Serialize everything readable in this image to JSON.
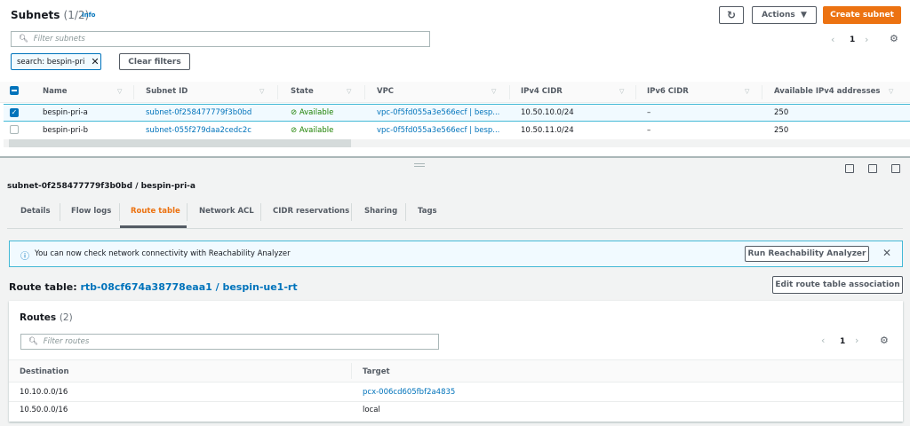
{
  "header": {
    "title": "Subnets",
    "count": "(1/2)",
    "info": "Info",
    "refresh_icon": "refresh-icon",
    "actions": "Actions",
    "create": "Create subnet"
  },
  "filter": {
    "placeholder": "Filter subnets",
    "chip": "search: bespin-pri",
    "clear": "Clear filters"
  },
  "pagination": {
    "page": "1"
  },
  "table": {
    "columns": [
      "Name",
      "Subnet ID",
      "State",
      "VPC",
      "IPv4 CIDR",
      "IPv6 CIDR",
      "Available IPv4 addresses"
    ],
    "rows": [
      {
        "selected": true,
        "name": "bespin-pri-a",
        "id": "subnet-0f258477779f3b0bd",
        "state": "Available",
        "vpc": "vpc-0f5fd055a3e566ecf | besp...",
        "ipv4": "10.50.10.0/24",
        "ipv6": "–",
        "avail": "250"
      },
      {
        "selected": false,
        "name": "bespin-pri-b",
        "id": "subnet-055f279daa2cedc2c",
        "state": "Available",
        "vpc": "vpc-0f5fd055a3e566ecf | besp...",
        "ipv4": "10.50.11.0/24",
        "ipv6": "–",
        "avail": "250"
      }
    ]
  },
  "detail": {
    "title": "subnet-0f258477779f3b0bd / bespin-pri-a",
    "tabs": [
      "Details",
      "Flow logs",
      "Route table",
      "Network ACL",
      "CIDR reservations",
      "Sharing",
      "Tags"
    ],
    "active_tab": "Route table",
    "alert": "You can now check network connectivity with Reachability Analyzer",
    "alert_button": "Run Reachability Analyzer",
    "rt_label": "Route table:",
    "rt_link": "rtb-08cf674a38778eaa1 / bespin-ue1-rt",
    "edit_button": "Edit route table association",
    "routes_title": "Routes",
    "routes_count": "(2)",
    "routes_placeholder": "Filter routes",
    "page": "1",
    "route_columns": [
      "Destination",
      "Target"
    ],
    "routes": [
      {
        "dest": "10.10.0.0/16",
        "target": "pcx-006cd605fbf2a4835",
        "link": true
      },
      {
        "dest": "10.50.0.0/16",
        "target": "local",
        "link": false
      }
    ]
  },
  "colors": {
    "accent": "#ec7211",
    "link": "#0073bb",
    "success": "#1d8102"
  }
}
